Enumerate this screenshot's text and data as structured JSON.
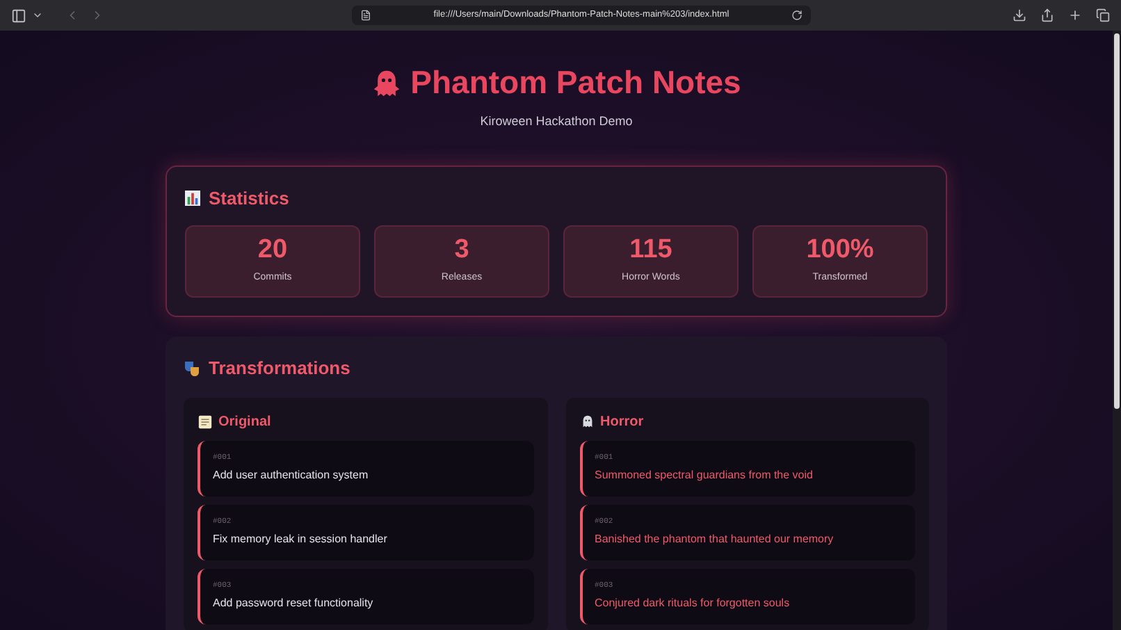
{
  "browser": {
    "url": "file:///Users/main/Downloads/Phantom-Patch-Notes-main%203/index.html"
  },
  "header": {
    "title": "Phantom Patch Notes",
    "subtitle": "Kiroween Hackathon Demo"
  },
  "statistics": {
    "title": "Statistics",
    "cards": [
      {
        "value": "20",
        "label": "Commits"
      },
      {
        "value": "3",
        "label": "Releases"
      },
      {
        "value": "115",
        "label": "Horror Words"
      },
      {
        "value": "100%",
        "label": "Transformed"
      }
    ]
  },
  "transformations": {
    "title": "Transformations",
    "columns": [
      {
        "kind": "original",
        "title": "Original",
        "entries": [
          {
            "id": "#001",
            "text": "Add user authentication system"
          },
          {
            "id": "#002",
            "text": "Fix memory leak in session handler"
          },
          {
            "id": "#003",
            "text": "Add password reset functionality"
          }
        ]
      },
      {
        "kind": "horror",
        "title": "Horror",
        "entries": [
          {
            "id": "#001",
            "text": "Summoned spectral guardians from the void"
          },
          {
            "id": "#002",
            "text": "Banished the phantom that haunted our memory"
          },
          {
            "id": "#003",
            "text": "Conjured dark rituals for forgotten souls"
          }
        ]
      }
    ]
  }
}
